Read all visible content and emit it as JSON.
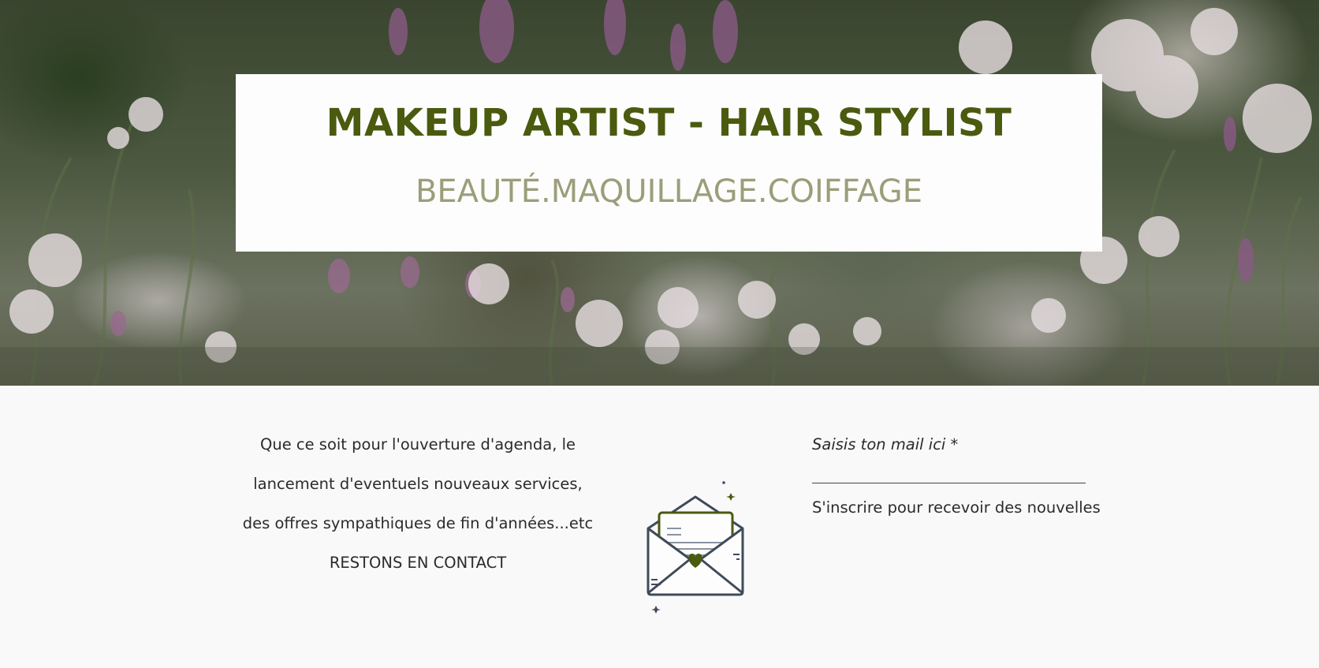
{
  "hero": {
    "title": "MAKEUP ARTIST - HAIR STYLIST",
    "subtitle": "BEAUTÉ.MAQUILLAGE.COIFFAGE"
  },
  "newsletter": {
    "text_lines": [
      "Que ce soit pour l'ouverture d'agenda, le",
      "lancement d'eventuels nouveaux services,",
      "des offres sympathiques de fin d'années...etc",
      "RESTONS EN CONTACT"
    ],
    "email_label": "Saisis ton mail ici *",
    "email_value": "",
    "subscribe_label": "S'inscrire pour recevoir des nouvelles",
    "icon": "open-envelope-heart-icon"
  },
  "colors": {
    "title": "#4a5a0f",
    "subtitle": "#9c9e7a",
    "page_background": "#f9f9f9",
    "envelope_stroke": "#3f4a5a",
    "envelope_accent": "#4a5a0f"
  }
}
